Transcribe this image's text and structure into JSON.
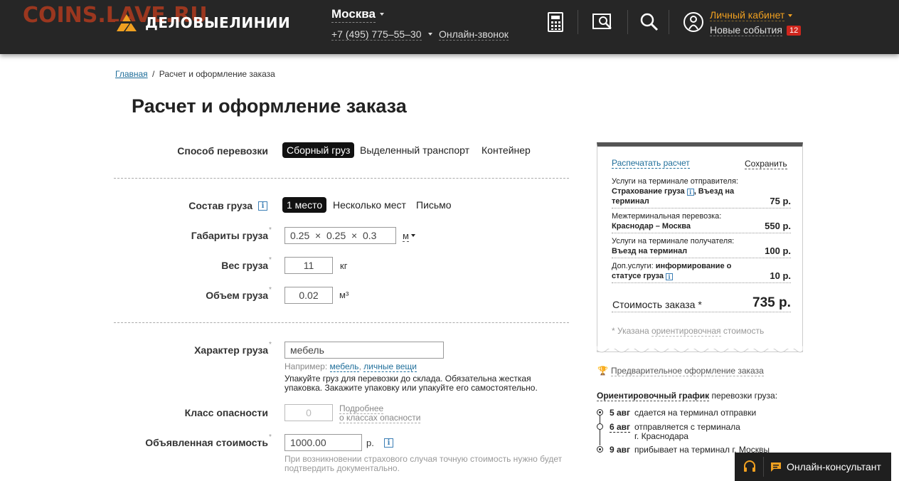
{
  "watermark": "COINS.LAVE.RU",
  "brand": {
    "name": "ДЕЛОВЫЕЛИНИИ",
    "accent": "#f0a020"
  },
  "header": {
    "city": "Москва",
    "phone": "+7 (495) 775–55–30",
    "online_call": "Онлайн-звонок",
    "icons": [
      "calculator-icon",
      "map-search-icon",
      "search-icon",
      "user-icon"
    ],
    "cabinet": "Личный кабинет",
    "events": "Новые события",
    "events_count": "12"
  },
  "breadcrumb": {
    "home": "Главная",
    "separator": "/",
    "current": "Расчет и оформление заказа"
  },
  "title": "Расчет и оформление заказа",
  "form": {
    "transport": {
      "label": "Способ перевозки",
      "options": [
        "Сборный груз",
        "Выделенный транспорт",
        "Контейнер"
      ],
      "selected": "Сборный груз"
    },
    "composition": {
      "label": "Состав груза",
      "options": [
        "1 место",
        "Несколько мест",
        "Письмо"
      ],
      "selected": "1 место"
    },
    "dimensions": {
      "label": "Габариты груза",
      "value": "0.25  ×  0.25  ×  0.3",
      "unit": "м"
    },
    "weight": {
      "label": "Вес груза",
      "value": "11",
      "unit": "кг"
    },
    "volume": {
      "label": "Объем груза",
      "value": "0.02",
      "unit": "м³"
    },
    "nature": {
      "label": "Характер груза",
      "value": "мебель",
      "hint_prefix": "Например:",
      "hint_links": [
        "мебель",
        "личные вещи"
      ],
      "note_line1": "Упакуйте груз для перевозки до склада. Обязательна жесткая",
      "note_line2": "упаковка. Закажите упаковку или упакуйте его самостоятельно."
    },
    "hazard": {
      "label": "Класс опасности",
      "value": "0",
      "link_line1": "Подробнее",
      "link_line2": "о классах опасности"
    },
    "declared": {
      "label": "Объявленная стоимость",
      "value": "1000.00",
      "unit": "р.",
      "note_line1": "При возникновении страхового случая точную стоимость нужно будет",
      "note_line2": "подтвердить документально."
    },
    "required_mark": "*",
    "info_mark": "i"
  },
  "summary": {
    "print": "Распечатать расчет",
    "save": "Сохранить",
    "items": [
      {
        "title": "Услуги на терминале отправителя:",
        "detail_a": "Страхование груза",
        "detail_b": ", Въезд на",
        "detail_c": "терминал",
        "price": "75 р."
      },
      {
        "title": "Межтерминальная перевозка:",
        "detail": "Краснодар – Москва",
        "price": "550 р."
      },
      {
        "title": "Услуги на терминале получателя:",
        "detail": "Въезд на терминал",
        "price": "100 р."
      },
      {
        "title_a": "Доп.услуги: ",
        "title_b": "информирование о",
        "detail": "статусе груза",
        "price": "10 р."
      }
    ],
    "total_label": "Стоимость заказа *",
    "total_value": "735 р.",
    "footnote_a": "* Указана ",
    "footnote_b": "ориентировочная",
    "footnote_c": " стоимость"
  },
  "prelim_order": "Предварительное оформление заказа",
  "schedule": {
    "title_a": "Ориентировочный график",
    "title_b": " перевозки груза:",
    "steps": [
      {
        "date": "5 авг",
        "text": "сдается на терминал отправки"
      },
      {
        "date": "6 авг",
        "text_line1": "отправляется с терминала",
        "text_line2": "г. Краснодара"
      },
      {
        "date": "9 авг",
        "text": "прибывает на терминал г. Москвы"
      }
    ]
  },
  "consultant": {
    "label": "Онлайн-консультант"
  }
}
